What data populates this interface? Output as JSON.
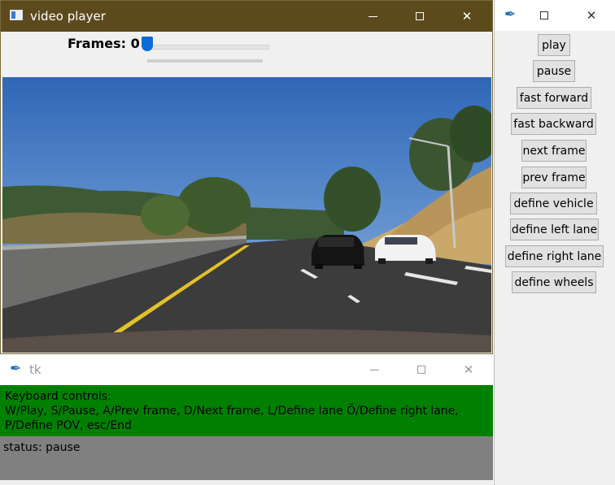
{
  "video_player": {
    "title": "video player",
    "frames_label": "Frames: 0",
    "frame_value": 0,
    "slider_position": 0.0
  },
  "controls_window": {
    "buttons": [
      {
        "label": "play"
      },
      {
        "label": "pause"
      },
      {
        "label": "fast forward"
      },
      {
        "label": "fast backward"
      },
      {
        "label": "next frame"
      },
      {
        "label": "prev frame"
      },
      {
        "label": "define vehicle"
      },
      {
        "label": "define left lane"
      },
      {
        "label": "define right lane"
      },
      {
        "label": "define wheels"
      }
    ]
  },
  "tk_window": {
    "title": "tk",
    "keyboard_heading": "Keyboard controls:",
    "keyboard_help": "W/Play, S/Pause, A/Prev frame, D/Next frame, L/Define lane Ö/Define right lane, P/Define POV, esc/End",
    "status": "status: pause"
  },
  "colors": {
    "title_bar": "#5c4a1c",
    "help_panel": "#008000",
    "status_panel": "#808080",
    "slider_thumb": "#0a6bd6"
  },
  "icons": [
    "window-app-icon",
    "feather-icon",
    "minimize-icon",
    "maximize-icon",
    "close-icon"
  ]
}
